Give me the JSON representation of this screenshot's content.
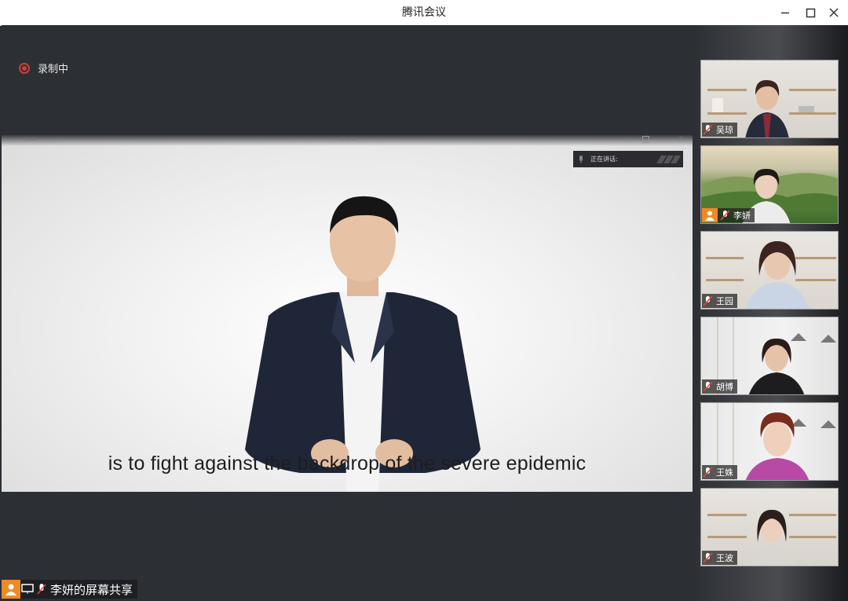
{
  "window": {
    "title": "腾讯会议",
    "controls": [
      "minimize-icon",
      "maximize-icon",
      "close-icon"
    ]
  },
  "recording": {
    "label": "录制中",
    "color": "#c9403a"
  },
  "shared_content": {
    "speaking_label": "正在讲话:",
    "subtitle": "is to fight against the backdrop of the severe epidemic",
    "mini_time_left": "06:45",
    "mini_time_center": "07:nnn"
  },
  "screen_share": {
    "label": "李妍的屏幕共享",
    "avatar_color": "#f08a24"
  },
  "participants": [
    {
      "name": "吴琼",
      "muted": true,
      "scene": "shelves"
    },
    {
      "name": "李妍",
      "muted": true,
      "scene": "landscape",
      "is_sharer": true
    },
    {
      "name": "王园",
      "muted": true,
      "scene": "shelves"
    },
    {
      "name": "胡博",
      "muted": true,
      "scene": "room"
    },
    {
      "name": "王姝",
      "muted": true,
      "scene": "room"
    },
    {
      "name": "王波",
      "muted": true,
      "scene": "shelves"
    }
  ]
}
